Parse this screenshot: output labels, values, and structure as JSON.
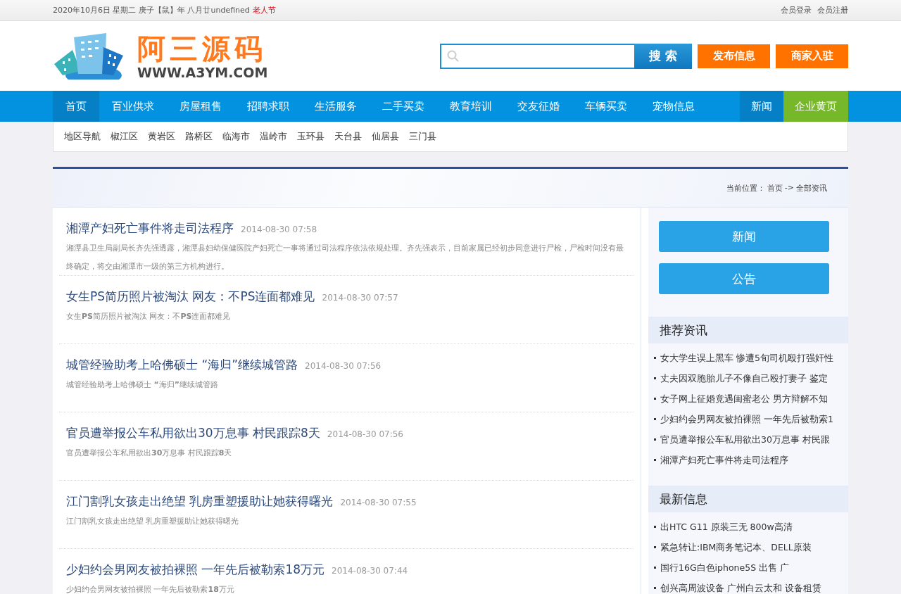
{
  "top_bar": {
    "date": "2020年10月6日 星期二  庚子【鼠】年 八月廿undefined",
    "festival": "老人节",
    "links": [
      "会员登录",
      "会员注册"
    ]
  },
  "logo": {
    "title": "阿三源码",
    "url": "WWW.A3YM.COM"
  },
  "search": {
    "button": "搜 索"
  },
  "header_buttons": [
    "发布信息",
    "商家入驻"
  ],
  "nav": [
    {
      "label": "首页",
      "selected": true
    },
    {
      "label": "百业供求",
      "selected": false
    },
    {
      "label": "房屋租售",
      "selected": false
    },
    {
      "label": "招聘求职",
      "selected": false
    },
    {
      "label": "生活服务",
      "selected": false
    },
    {
      "label": "二手买卖",
      "selected": false
    },
    {
      "label": "教育培训",
      "selected": false
    },
    {
      "label": "交友征婚",
      "selected": false
    },
    {
      "label": "车辆买卖",
      "selected": false
    },
    {
      "label": "宠物信息",
      "selected": false
    }
  ],
  "nav_right": [
    {
      "label": "新闻",
      "color": "#0580c6"
    },
    {
      "label": "企业黄页",
      "color": "#77b82a"
    }
  ],
  "regions": {
    "label": "地区导航",
    "items": [
      "椒江区",
      "黄岩区",
      "路桥区",
      "临海市",
      "温岭市",
      "玉环县",
      "天台县",
      "仙居县",
      "三门县"
    ]
  },
  "breadcrumb": {
    "label": "当前位置：",
    "home": "首页",
    "sep": "->",
    "current": "全部资讯"
  },
  "articles": [
    {
      "title": "湘潭产妇死亡事件将走司法程序",
      "time": "2014-08-30 07:58",
      "summary": "湘潭县卫生局副局长齐先强透露，湘潭县妇幼保健医院产妇死亡一事将通过司法程序依法依规处理。齐先强表示，目前家属已经初步同意进行尸检，尸检时间没有最终确定，将交由湘潭市一级的第三方机构进行。"
    },
    {
      "title": "女生PS简历照片被淘汰 网友：不PS连面都难见",
      "time": "2014-08-30 07:57",
      "summary": "女生**PS**简历照片被淘汰 网友：不**PS**连面都难见"
    },
    {
      "title": "城管经验助考上哈佛硕士 “海归”继续城管路",
      "time": "2014-08-30 07:56",
      "summary": "城管经验助考上哈佛硕士 **“**海归**”**继续城管路"
    },
    {
      "title": "官员遭举报公车私用欲出30万息事 村民跟踪8天",
      "time": "2014-08-30 07:56",
      "summary": "官员遭举报公车私用欲出**30**万息事 村民跟踪**8**天"
    },
    {
      "title": "江门割乳女孩走出绝望 乳房重塑援助让她获得曙光",
      "time": "2014-08-30 07:55",
      "summary": "江门割乳女孩走出绝望 乳房重塑援助让她获得曙光"
    },
    {
      "title": "少妇约会男网友被拍裸照 一年先后被勒索18万元",
      "time": "2014-08-30 07:44",
      "summary": "少妇约会男网友被拍裸照 一年先后被勒索**18**万元"
    }
  ],
  "side_buttons": [
    "新闻",
    "公告"
  ],
  "side_sections": [
    {
      "title": "推荐资讯",
      "items": [
        "女大学生误上黑车 惨遭5旬司机殴打强奸性",
        "丈夫因双胞胎儿子不像自己殴打妻子 鉴定",
        "女子网上征婚竟遇闺蜜老公 男方辩解不知",
        "少妇约会男网友被拍裸照 一年先后被勒索1",
        "官员遭举报公车私用欲出30万息事 村民跟",
        "湘潭产妇死亡事件将走司法程序"
      ]
    },
    {
      "title": "最新信息",
      "items": [
        "出HTC G11 原装三无 800w高清",
        "紧急转让:IBM商务笔记本、DELL原装",
        "国行16G白色iphone5S 出售 广",
        "创兴高周波设备 广州白云太和 设备租赁"
      ]
    }
  ]
}
